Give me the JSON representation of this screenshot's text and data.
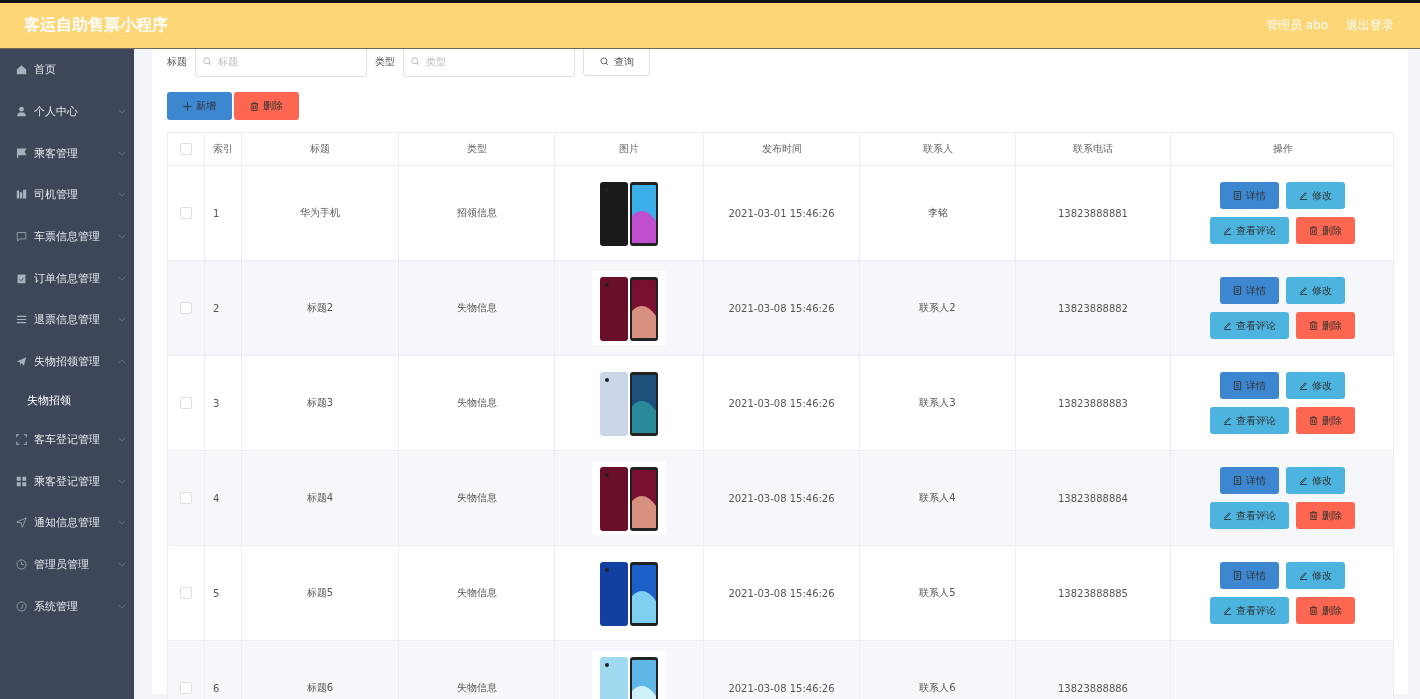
{
  "header": {
    "title": "客运自助售票小程序",
    "user": "管理员 abo",
    "logout": "退出登录"
  },
  "sidebar": {
    "items": [
      {
        "label": "首页",
        "expandable": false
      },
      {
        "label": "个人中心",
        "expandable": true,
        "expanded": false
      },
      {
        "label": "乘客管理",
        "expandable": true,
        "expanded": false
      },
      {
        "label": "司机管理",
        "expandable": true,
        "expanded": false
      },
      {
        "label": "车票信息管理",
        "expandable": true,
        "expanded": false
      },
      {
        "label": "订单信息管理",
        "expandable": true,
        "expanded": false
      },
      {
        "label": "退票信息管理",
        "expandable": true,
        "expanded": false
      },
      {
        "label": "失物招领管理",
        "expandable": true,
        "expanded": true,
        "children": [
          {
            "label": "失物招领"
          }
        ]
      },
      {
        "label": "客车登记管理",
        "expandable": true,
        "expanded": false
      },
      {
        "label": "乘客登记管理",
        "expandable": true,
        "expanded": false
      },
      {
        "label": "通知信息管理",
        "expandable": true,
        "expanded": false
      },
      {
        "label": "管理员管理",
        "expandable": true,
        "expanded": false
      },
      {
        "label": "系统管理",
        "expandable": true,
        "expanded": false
      }
    ]
  },
  "search": {
    "fields": [
      {
        "label": "标题",
        "placeholder": "标题"
      },
      {
        "label": "类型",
        "placeholder": "类型"
      }
    ],
    "button": "查询"
  },
  "actions": [
    {
      "kind": "add",
      "label": "新增"
    },
    {
      "kind": "delete",
      "label": "删除"
    }
  ],
  "table": {
    "all_checked": false,
    "columns": [
      "索引",
      "标题",
      "类型",
      "图片",
      "发布时间",
      "联系人",
      "联系电话",
      "操作"
    ],
    "rows": [
      {
        "checked": false,
        "index": "1",
        "title": "华为手机",
        "type": "招领信息",
        "time": "2021-03-01 15:46:26",
        "contact": "李铭",
        "phone": "13823888881",
        "buttons": [
          {
            "kind": "detail",
            "label": "详情"
          },
          {
            "kind": "edit",
            "label": "修改"
          },
          {
            "kind": "comment",
            "label": "查看评论"
          },
          {
            "kind": "delete",
            "label": "删除"
          }
        ]
      },
      {
        "checked": false,
        "index": "2",
        "title": "标题2",
        "type": "失物信息",
        "time": "2021-03-08 15:46:26",
        "contact": "联系人2",
        "phone": "13823888882",
        "buttons": [
          {
            "kind": "detail",
            "label": "详情"
          },
          {
            "kind": "edit",
            "label": "修改"
          },
          {
            "kind": "comment",
            "label": "查看评论"
          },
          {
            "kind": "delete",
            "label": "删除"
          }
        ]
      },
      {
        "checked": false,
        "index": "3",
        "title": "标题3",
        "type": "失物信息",
        "time": "2021-03-08 15:46:26",
        "contact": "联系人3",
        "phone": "13823888883",
        "buttons": [
          {
            "kind": "detail",
            "label": "详情"
          },
          {
            "kind": "edit",
            "label": "修改"
          },
          {
            "kind": "comment",
            "label": "查看评论"
          },
          {
            "kind": "delete",
            "label": "删除"
          }
        ]
      },
      {
        "checked": false,
        "index": "4",
        "title": "标题4",
        "type": "失物信息",
        "time": "2021-03-08 15:46:26",
        "contact": "联系人4",
        "phone": "13823888884",
        "buttons": [
          {
            "kind": "detail",
            "label": "详情"
          },
          {
            "kind": "edit",
            "label": "修改"
          },
          {
            "kind": "comment",
            "label": "查看评论"
          },
          {
            "kind": "delete",
            "label": "删除"
          }
        ]
      },
      {
        "checked": false,
        "index": "5",
        "title": "标题5",
        "type": "失物信息",
        "time": "2021-03-08 15:46:26",
        "contact": "联系人5",
        "phone": "13823888885",
        "buttons": [
          {
            "kind": "detail",
            "label": "详情"
          },
          {
            "kind": "edit",
            "label": "修改"
          },
          {
            "kind": "comment",
            "label": "查看评论"
          },
          {
            "kind": "delete",
            "label": "删除"
          }
        ]
      },
      {
        "checked": false,
        "index": "6",
        "title": "标题6",
        "type": "失物信息",
        "time": "2021-03-08 15:46:26",
        "contact": "联系人6",
        "phone": "13823888886",
        "buttons": []
      }
    ]
  }
}
